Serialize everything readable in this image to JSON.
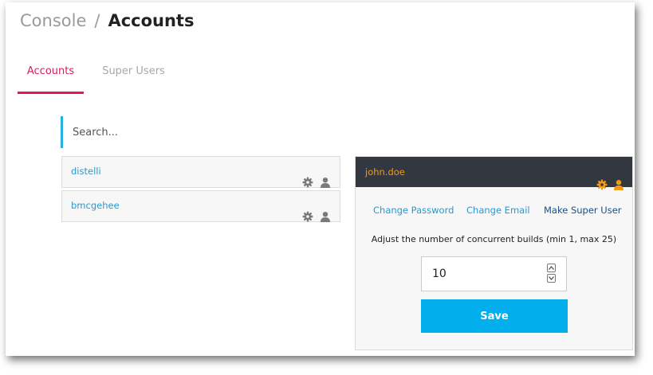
{
  "breadcrumb": {
    "root": "Console",
    "separator": "/",
    "current": "Accounts"
  },
  "tabs": [
    {
      "label": "Accounts",
      "active": true
    },
    {
      "label": "Super Users",
      "active": false
    }
  ],
  "search": {
    "placeholder": "Search...",
    "value": ""
  },
  "accounts": [
    {
      "name": "distelli",
      "icons": [
        "gear-icon",
        "user-icon"
      ]
    },
    {
      "name": "bmcgehee",
      "icons": [
        "gear-icon",
        "user-icon"
      ]
    }
  ],
  "detail": {
    "username": "john.doe",
    "header_icons": [
      "gear-icon",
      "user-icon"
    ],
    "actions": {
      "change_password": "Change Password",
      "change_email": "Change Email",
      "make_super_user": "Make Super User"
    },
    "builds_label": "Adjust the number of concurrent builds (min 1, max 25)",
    "builds_value": "10",
    "save_label": "Save"
  },
  "colors": {
    "accent_pink": "#e0185e",
    "link_blue": "#2a98cc",
    "header_dark": "#333740",
    "username_orange": "#ee9a1c",
    "save_blue": "#03aeed",
    "row_icon_gray": "#7a7a7a",
    "header_icon_orange": "#f29a1a"
  }
}
